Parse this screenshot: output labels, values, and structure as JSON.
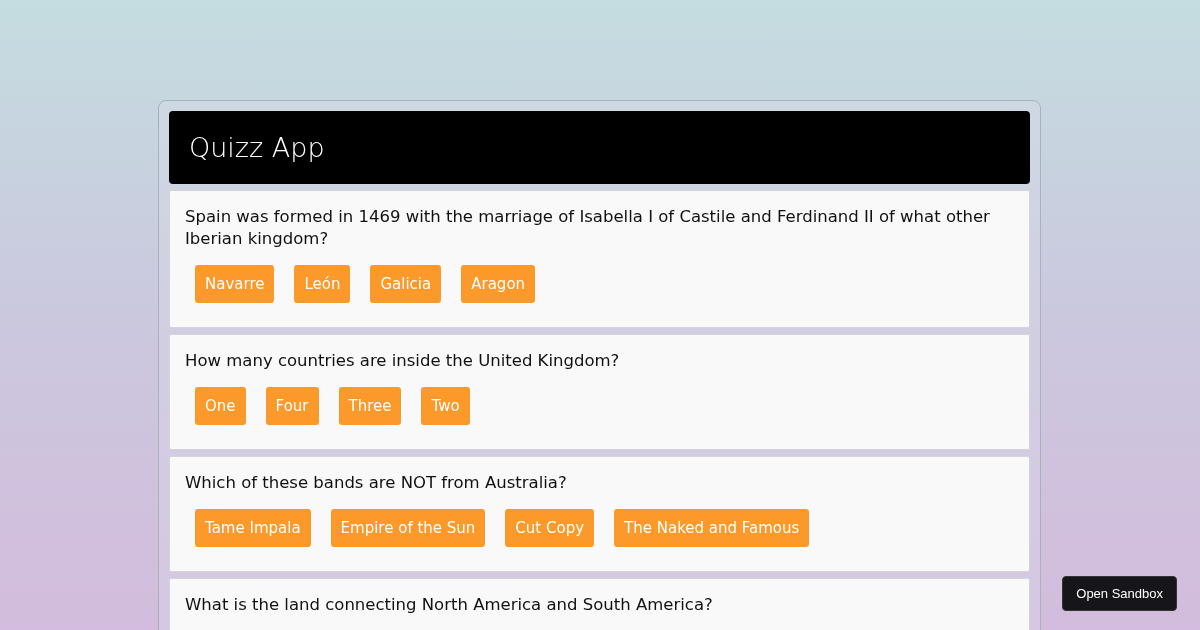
{
  "app": {
    "title": "Quizz App"
  },
  "questions": [
    {
      "text": "Spain was formed in 1469 with the marriage of Isabella I of Castile and Ferdinand II of what other Iberian kingdom?",
      "answers": [
        "Navarre",
        "León",
        "Galicia",
        "Aragon"
      ]
    },
    {
      "text": "How many countries are inside the United Kingdom?",
      "answers": [
        "One",
        "Four",
        "Three",
        "Two"
      ]
    },
    {
      "text": "Which of these bands are NOT from Australia?",
      "answers": [
        "Tame Impala",
        "Empire of the Sun",
        "Cut Copy",
        "The Naked and Famous"
      ]
    },
    {
      "text": "What is the land connecting North America and South America?"
    }
  ],
  "sandbox_button": "Open Sandbox"
}
